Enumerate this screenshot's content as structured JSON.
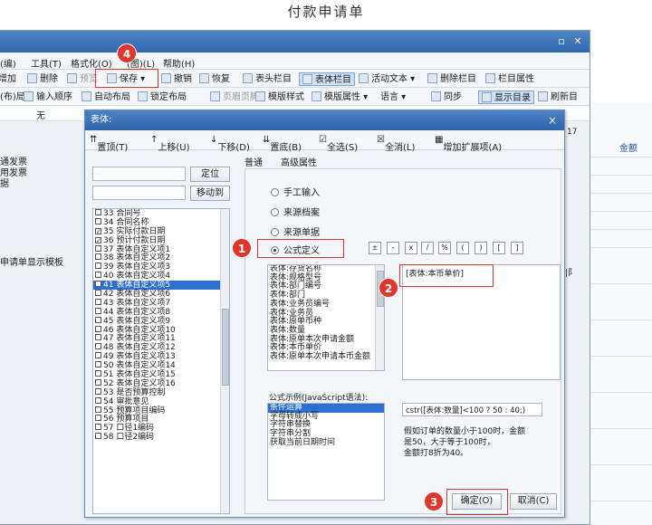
{
  "page_title": "付款申请单",
  "back": {
    "menu": [
      "(编)",
      "工具(T)",
      "格式化(O)",
      "(图)(L)",
      "帮助(H)"
    ],
    "toolbar1": [
      "增加",
      "删除",
      "预览",
      "保存",
      "撤销",
      "恢复",
      "表头栏目",
      "表体栏目",
      "活动文本",
      "删除栏目",
      "栏目属性"
    ],
    "toolbar2": [
      "(布)局",
      "输入顺序",
      "自动布局",
      "锁定布局",
      "页眉页脚",
      "模版样式",
      "模版属性",
      "语言",
      "同步",
      "显示目录",
      "刷新目"
    ],
    "field_value": "无",
    "left_labels": [
      "通发票",
      "用发票",
      "据",
      "",
      "",
      "",
      "",
      "",
      "",
      "",
      "申请单显示模板"
    ],
    "right_header": "金额",
    "ruler_mark": "17",
    "right_tag": "|阝"
  },
  "dialog": {
    "title": "表体:",
    "close_glyph": "×",
    "toolbar": [
      "置顶(T)",
      "上移(U)",
      "下移(D)",
      "置底(B)",
      "全选(S)",
      "全消(L)",
      "增加扩展项(A)"
    ],
    "locate_btn": "定位",
    "move_btn": "移动到",
    "items": [
      {
        "label": "33  合同号",
        "checked": false
      },
      {
        "label": "34  合同名称",
        "checked": false
      },
      {
        "label": "35  实际付款日期",
        "checked": true
      },
      {
        "label": "36  预计付款日期",
        "checked": true
      },
      {
        "label": "37  表体自定义项1",
        "checked": false
      },
      {
        "label": "38  表体自定义项2",
        "checked": false
      },
      {
        "label": "39  表体自定义项3",
        "checked": false
      },
      {
        "label": "40  表体自定义项4",
        "checked": false
      },
      {
        "label": "41  表体自定义项5",
        "checked": false
      },
      {
        "label": "42  表体自定义项6",
        "checked": false
      },
      {
        "label": "43  表体自定义项7",
        "checked": false
      },
      {
        "label": "44  表体自定义项8",
        "checked": false
      },
      {
        "label": "45  表体自定义项9",
        "checked": false
      },
      {
        "label": "46  表体自定义项10",
        "checked": false
      },
      {
        "label": "47  表体自定义项11",
        "checked": false
      },
      {
        "label": "48  表体自定义项12",
        "checked": false
      },
      {
        "label": "49  表体自定义项13",
        "checked": false
      },
      {
        "label": "50  表体自定义项14",
        "checked": false
      },
      {
        "label": "51  表体自定义项15",
        "checked": false
      },
      {
        "label": "52  表体自定义项16",
        "checked": false
      },
      {
        "label": "53  是否预算控制",
        "checked": false
      },
      {
        "label": "54  审批意见",
        "checked": false
      },
      {
        "label": "55  预算项目编码",
        "checked": false
      },
      {
        "label": "56  预算项目",
        "checked": false
      },
      {
        "label": "57  口径1编码",
        "checked": false
      },
      {
        "label": "58  口径2编码",
        "checked": false
      }
    ],
    "selected_index": 8,
    "tabs": [
      "普通",
      "高级属性"
    ],
    "radios": [
      "手工输入",
      "来源档案",
      "来源单据",
      "公式定义"
    ],
    "radio_selected": 3,
    "operators": [
      "±",
      "-",
      "ⅹ",
      "/",
      "%",
      "(",
      ")",
      "[",
      "]"
    ],
    "fields": [
      "表体:存货名称",
      "表体:规格型号",
      "表体:部门编号",
      "表体:部门",
      "表体:业务员编号",
      "表体:业务员",
      "表体:原单币种",
      "表体:数量",
      "表体:原单本次申请金额",
      "表体:本币单价",
      "表体:原单本次申请本币金额"
    ],
    "formula": "[表体:本币单价]",
    "examples_label": "公式示例(JavaScript语法):",
    "examples": [
      "条件运算",
      "字母转成小写",
      "字符串替换",
      "字符串分割",
      "获取当前日期时间"
    ],
    "example_code": "cstr([表体:数量]<100 ? 50 : 40;)",
    "example_desc": [
      "假如订单的数量小于100时，金额",
      "是50，大于等于100时，",
      "金额打8折为40。"
    ],
    "ok_btn": "确定(O)",
    "cancel_btn": "取消(C)"
  },
  "markers": [
    "1",
    "2",
    "3",
    "4"
  ]
}
